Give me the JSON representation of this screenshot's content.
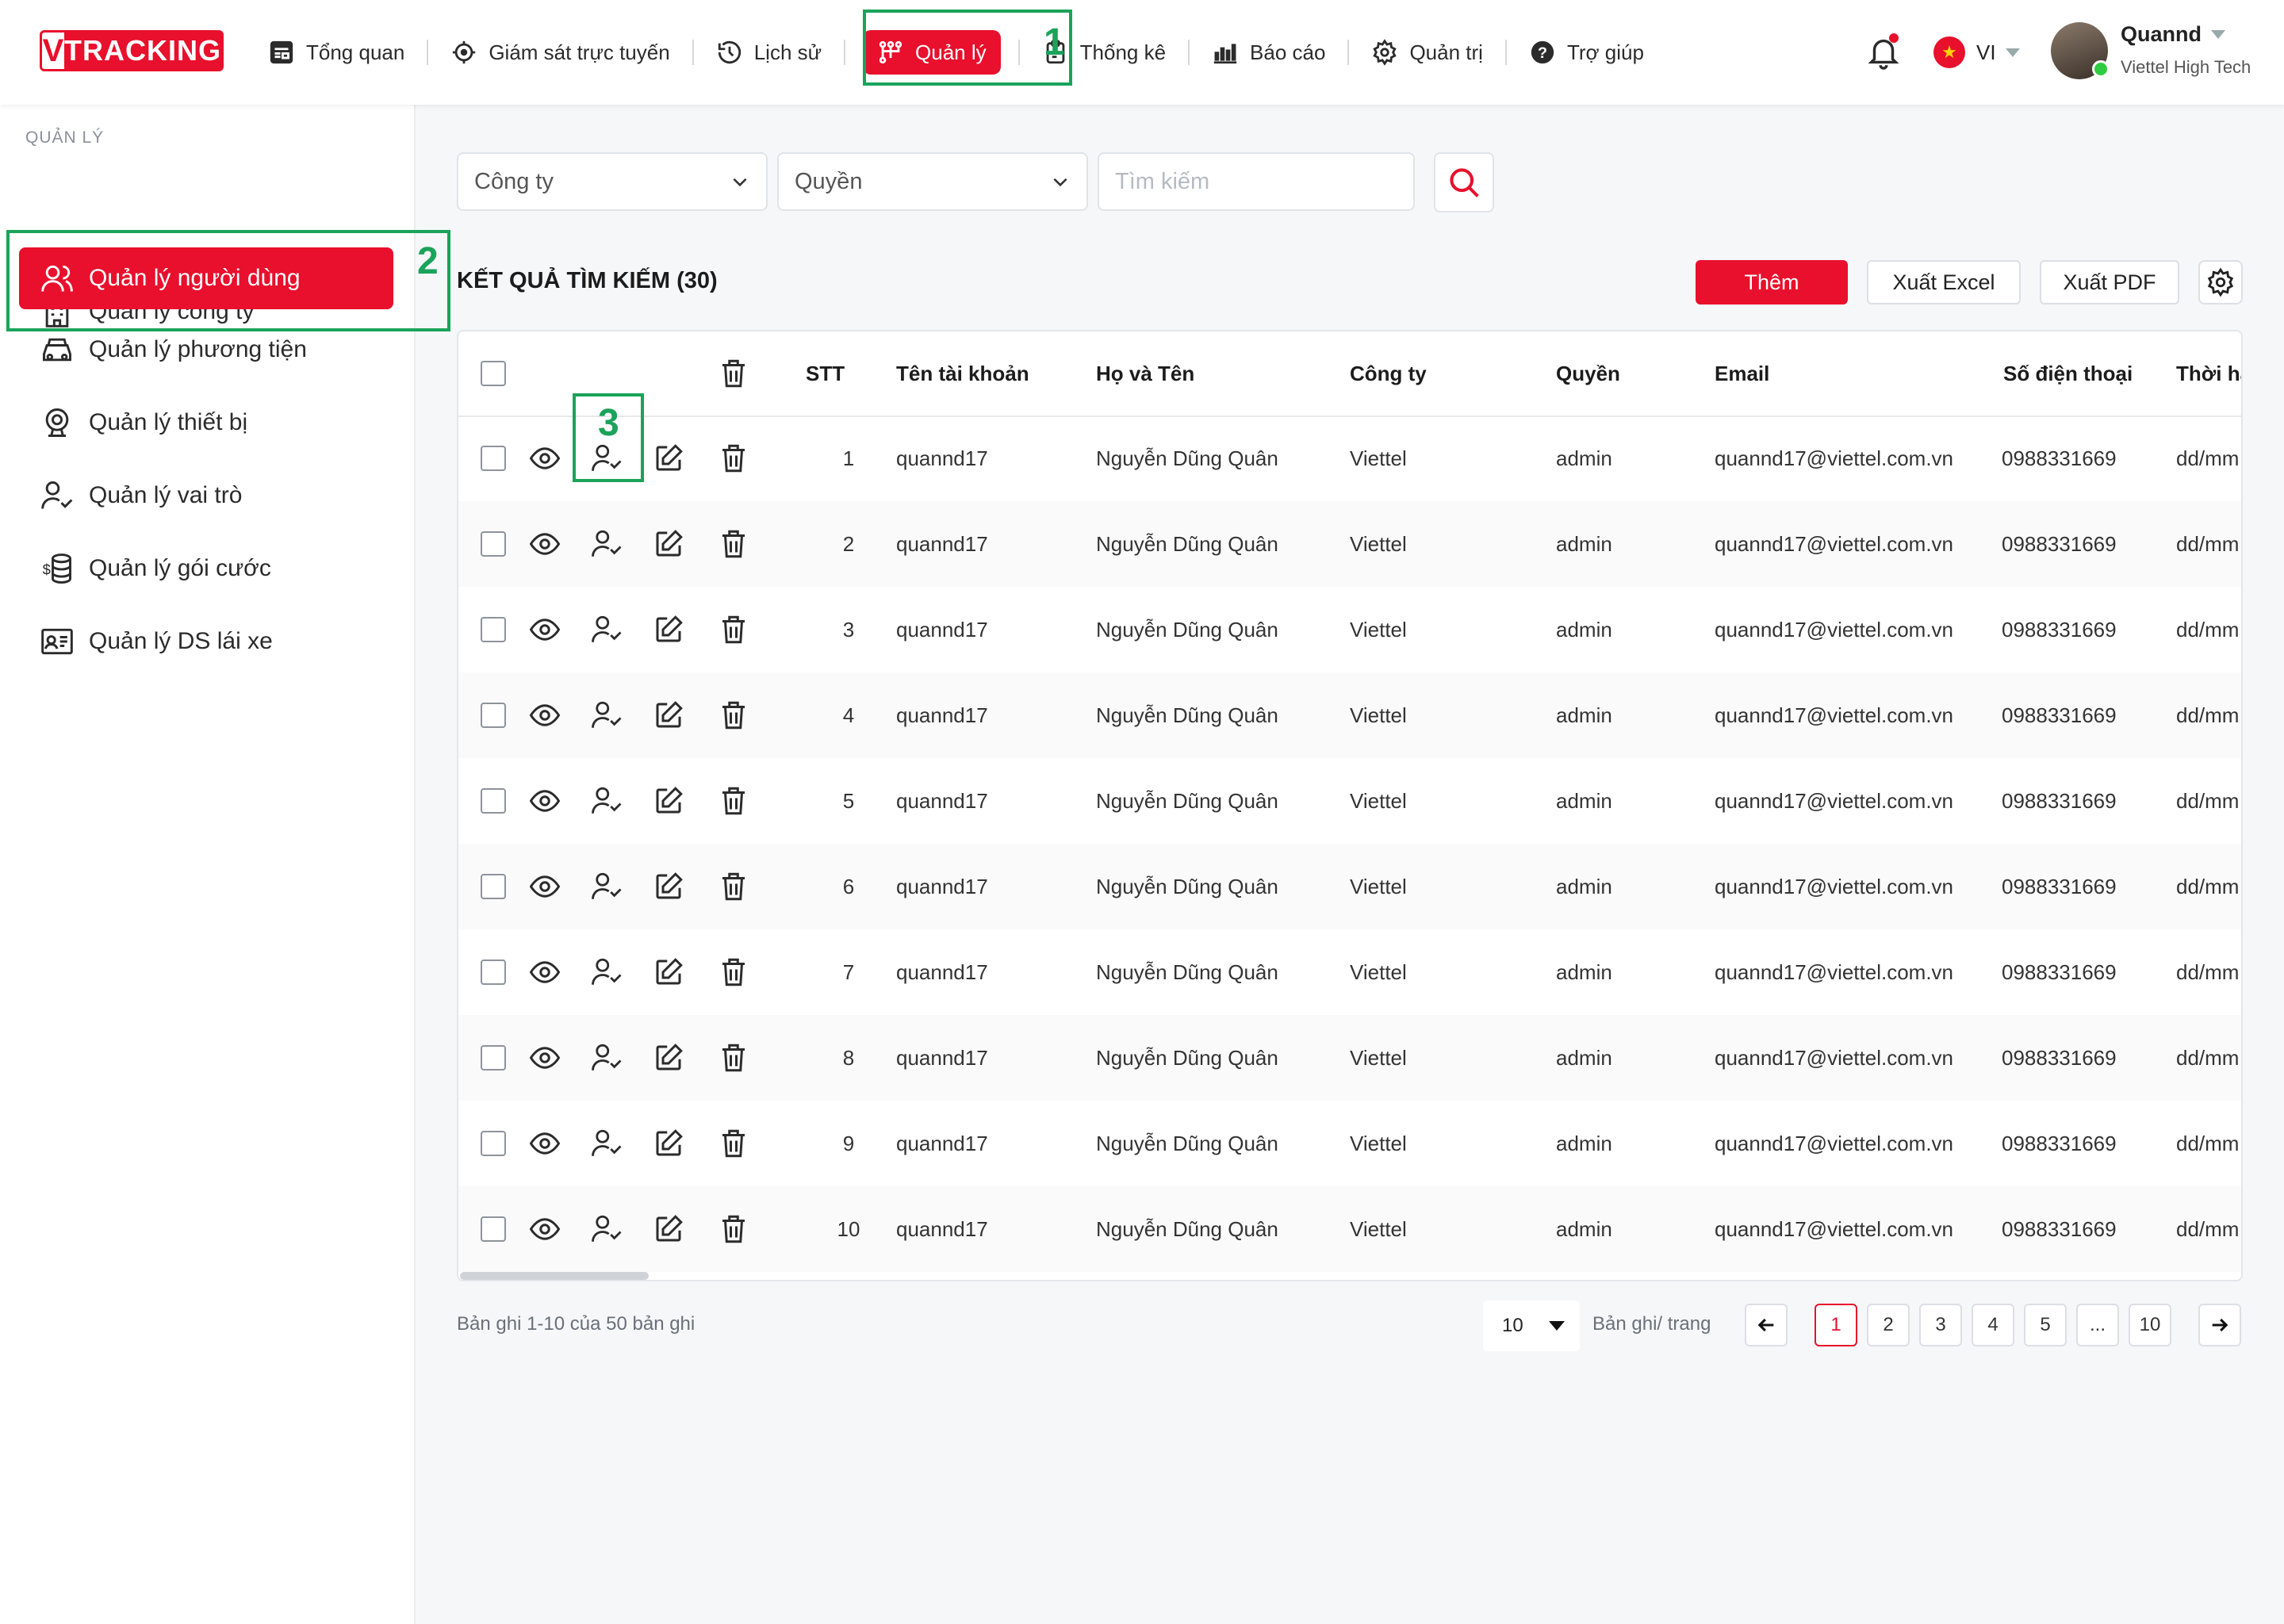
{
  "brand": {
    "logo_v": "V",
    "logo_text": "TRACKING"
  },
  "nav": [
    {
      "label": "Tổng quan",
      "icon": "dashboard-icon"
    },
    {
      "label": "Giám sát trực tuyến",
      "icon": "target-icon"
    },
    {
      "label": "Lịch sử",
      "icon": "history-icon"
    },
    {
      "label": "Quản lý",
      "icon": "manage-icon",
      "active": true
    },
    {
      "label": "Thống kê",
      "icon": "clipboard-icon"
    },
    {
      "label": "Báo cáo",
      "icon": "bar-chart-icon"
    },
    {
      "label": "Quản trị",
      "icon": "gear-icon"
    },
    {
      "label": "Trợ giúp",
      "icon": "help-icon"
    }
  ],
  "annotations": {
    "n1": "1",
    "n2": "2",
    "n3": "3"
  },
  "header": {
    "lang": "VI",
    "user_name": "Quannd",
    "user_org": "Viettel High Tech"
  },
  "sidebar": {
    "title": "QUẢN LÝ",
    "items": [
      {
        "label": "Quản lý công ty",
        "icon": "building-icon"
      },
      {
        "label": "Quản lý người dùng",
        "icon": "users-icon",
        "active": true
      },
      {
        "label": "Quản lý phương tiện",
        "icon": "car-icon"
      },
      {
        "label": "Quản lý thiết bị",
        "icon": "device-icon"
      },
      {
        "label": "Quản lý vai trò",
        "icon": "user-check-icon"
      },
      {
        "label": "Quản lý gói cước",
        "icon": "coins-icon"
      },
      {
        "label": "Quản lý DS lái xe",
        "icon": "id-card-icon"
      }
    ]
  },
  "filters": {
    "company": "Công ty",
    "role": "Quyền",
    "search_placeholder": "Tìm kiếm"
  },
  "results": {
    "title": "KẾT QUẢ TÌM KIẾM (30)",
    "add": "Thêm",
    "export_excel": "Xuất Excel",
    "export_pdf": "Xuất PDF"
  },
  "table": {
    "columns": {
      "stt": "STT",
      "username": "Tên tài khoản",
      "fullname": "Họ và Tên",
      "company": "Công ty",
      "role": "Quyền",
      "email": "Email",
      "phone": "Số điện thoại",
      "expiry": "Thời hạ"
    },
    "rows": [
      {
        "stt": "1",
        "username": "quannd17",
        "fullname": "Nguyễn Dũng Quân",
        "company": "Viettel",
        "role": "admin",
        "email": "quannd17@viettel.com.vn",
        "phone": "0988331669",
        "expiry": "dd/mm"
      },
      {
        "stt": "2",
        "username": "quannd17",
        "fullname": "Nguyễn Dũng Quân",
        "company": "Viettel",
        "role": "admin",
        "email": "quannd17@viettel.com.vn",
        "phone": "0988331669",
        "expiry": "dd/mm"
      },
      {
        "stt": "3",
        "username": "quannd17",
        "fullname": "Nguyễn Dũng Quân",
        "company": "Viettel",
        "role": "admin",
        "email": "quannd17@viettel.com.vn",
        "phone": "0988331669",
        "expiry": "dd/mm"
      },
      {
        "stt": "4",
        "username": "quannd17",
        "fullname": "Nguyễn Dũng Quân",
        "company": "Viettel",
        "role": "admin",
        "email": "quannd17@viettel.com.vn",
        "phone": "0988331669",
        "expiry": "dd/mm"
      },
      {
        "stt": "5",
        "username": "quannd17",
        "fullname": "Nguyễn Dũng Quân",
        "company": "Viettel",
        "role": "admin",
        "email": "quannd17@viettel.com.vn",
        "phone": "0988331669",
        "expiry": "dd/mm"
      },
      {
        "stt": "6",
        "username": "quannd17",
        "fullname": "Nguyễn Dũng Quân",
        "company": "Viettel",
        "role": "admin",
        "email": "quannd17@viettel.com.vn",
        "phone": "0988331669",
        "expiry": "dd/mm"
      },
      {
        "stt": "7",
        "username": "quannd17",
        "fullname": "Nguyễn Dũng Quân",
        "company": "Viettel",
        "role": "admin",
        "email": "quannd17@viettel.com.vn",
        "phone": "0988331669",
        "expiry": "dd/mm"
      },
      {
        "stt": "8",
        "username": "quannd17",
        "fullname": "Nguyễn Dũng Quân",
        "company": "Viettel",
        "role": "admin",
        "email": "quannd17@viettel.com.vn",
        "phone": "0988331669",
        "expiry": "dd/mm"
      },
      {
        "stt": "9",
        "username": "quannd17",
        "fullname": "Nguyễn Dũng Quân",
        "company": "Viettel",
        "role": "admin",
        "email": "quannd17@viettel.com.vn",
        "phone": "0988331669",
        "expiry": "dd/mm"
      },
      {
        "stt": "10",
        "username": "quannd17",
        "fullname": "Nguyễn Dũng Quân",
        "company": "Viettel",
        "role": "admin",
        "email": "quannd17@viettel.com.vn",
        "phone": "0988331669",
        "expiry": "dd/mm"
      }
    ]
  },
  "pagination": {
    "info": "Bản ghi 1-10 của 50 bản ghi",
    "page_size": "10",
    "per_page_label": "Bản ghi/ trang",
    "pages": [
      "1",
      "2",
      "3",
      "4",
      "5",
      "...",
      "10"
    ],
    "current": "1"
  },
  "colors": {
    "accent": "#e8102c",
    "highlight": "#1aa35a"
  }
}
